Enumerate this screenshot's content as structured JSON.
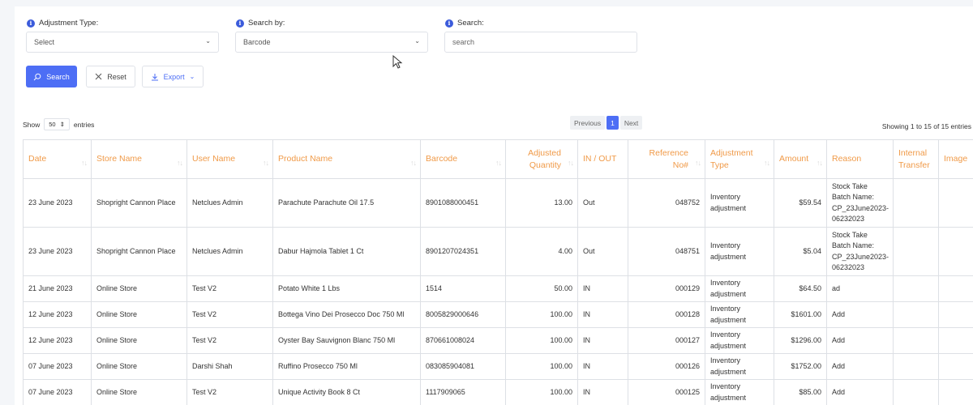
{
  "filters": {
    "adjustment_type": {
      "label": "Adjustment Type:",
      "value": "Select"
    },
    "search_by": {
      "label": "Search by:",
      "value": "Barcode"
    },
    "search": {
      "label": "Search:",
      "placeholder": "search"
    }
  },
  "buttons": {
    "search": "Search",
    "reset": "Reset",
    "export": "Export"
  },
  "table_controls": {
    "show": "Show",
    "length": "50",
    "entries": "entries",
    "previous": "Previous",
    "current_page": "1",
    "next": "Next",
    "showing": "Showing 1 to 15 of 15 entries"
  },
  "columns": [
    "Date",
    "Store Name",
    "User Name",
    "Product Name",
    "Barcode",
    "Adjusted Quantity",
    "IN / OUT",
    "Reference No#",
    "Adjustment Type",
    "Amount",
    "Reason",
    "Internal Transfer",
    "Image"
  ],
  "rows": [
    {
      "date": "23 June 2023",
      "store": "Shopright Cannon Place",
      "user": "Netclues Admin",
      "product": "Parachute Parachute Oil 17.5",
      "barcode": "8901088000451",
      "qty": "13.00",
      "inout": "Out",
      "ref": "048752",
      "type": "Inventory adjustment",
      "amount": "$59.54",
      "reason": "Stock Take Batch Name: CP_23June2023-06232023",
      "transfer": "",
      "image": ""
    },
    {
      "date": "23 June 2023",
      "store": "Shopright Cannon Place",
      "user": "Netclues Admin",
      "product": "Dabur Hajmola Tablet 1 Ct",
      "barcode": "8901207024351",
      "qty": "4.00",
      "inout": "Out",
      "ref": "048751",
      "type": "Inventory adjustment",
      "amount": "$5.04",
      "reason": "Stock Take Batch Name: CP_23June2023-06232023",
      "transfer": "",
      "image": ""
    },
    {
      "date": "21 June 2023",
      "store": "Online Store",
      "user": "Test V2",
      "product": "Potato White 1 Lbs",
      "barcode": "1514",
      "qty": "50.00",
      "inout": "IN",
      "ref": "000129",
      "type": "Inventory adjustment",
      "amount": "$64.50",
      "reason": "ad",
      "transfer": "",
      "image": ""
    },
    {
      "date": "12 June 2023",
      "store": "Online Store",
      "user": "Test V2",
      "product": "Bottega Vino Dei Prosecco Doc 750 Ml",
      "barcode": "8005829000646",
      "qty": "100.00",
      "inout": "IN",
      "ref": "000128",
      "type": "Inventory adjustment",
      "amount": "$1601.00",
      "reason": "Add",
      "transfer": "",
      "image": ""
    },
    {
      "date": "12 June 2023",
      "store": "Online Store",
      "user": "Test V2",
      "product": "Oyster Bay Sauvignon Blanc 750 Ml",
      "barcode": "870661008024",
      "qty": "100.00",
      "inout": "IN",
      "ref": "000127",
      "type": "Inventory adjustment",
      "amount": "$1296.00",
      "reason": "Add",
      "transfer": "",
      "image": ""
    },
    {
      "date": "07 June 2023",
      "store": "Online Store",
      "user": "Darshi Shah",
      "product": "Ruffino Prosecco 750 Ml",
      "barcode": "083085904081",
      "qty": "100.00",
      "inout": "IN",
      "ref": "000126",
      "type": "Inventory adjustment",
      "amount": "$1752.00",
      "reason": "Add",
      "transfer": "",
      "image": ""
    },
    {
      "date": "07 June 2023",
      "store": "Online Store",
      "user": "Test V2",
      "product": "Unique Activity Book 8 Ct",
      "barcode": "1117909065",
      "qty": "100.00",
      "inout": "IN",
      "ref": "000125",
      "type": "Inventory adjustment",
      "amount": "$85.00",
      "reason": "Add",
      "transfer": "",
      "image": ""
    }
  ],
  "colors": {
    "accent": "#4d6ef5",
    "header_text": "#f09a48",
    "border": "#dde0e5"
  },
  "icons": [
    "info-icon",
    "chevron-down-icon",
    "search-icon",
    "close-icon",
    "download-icon",
    "sort-icon",
    "mouse-cursor-icon"
  ]
}
